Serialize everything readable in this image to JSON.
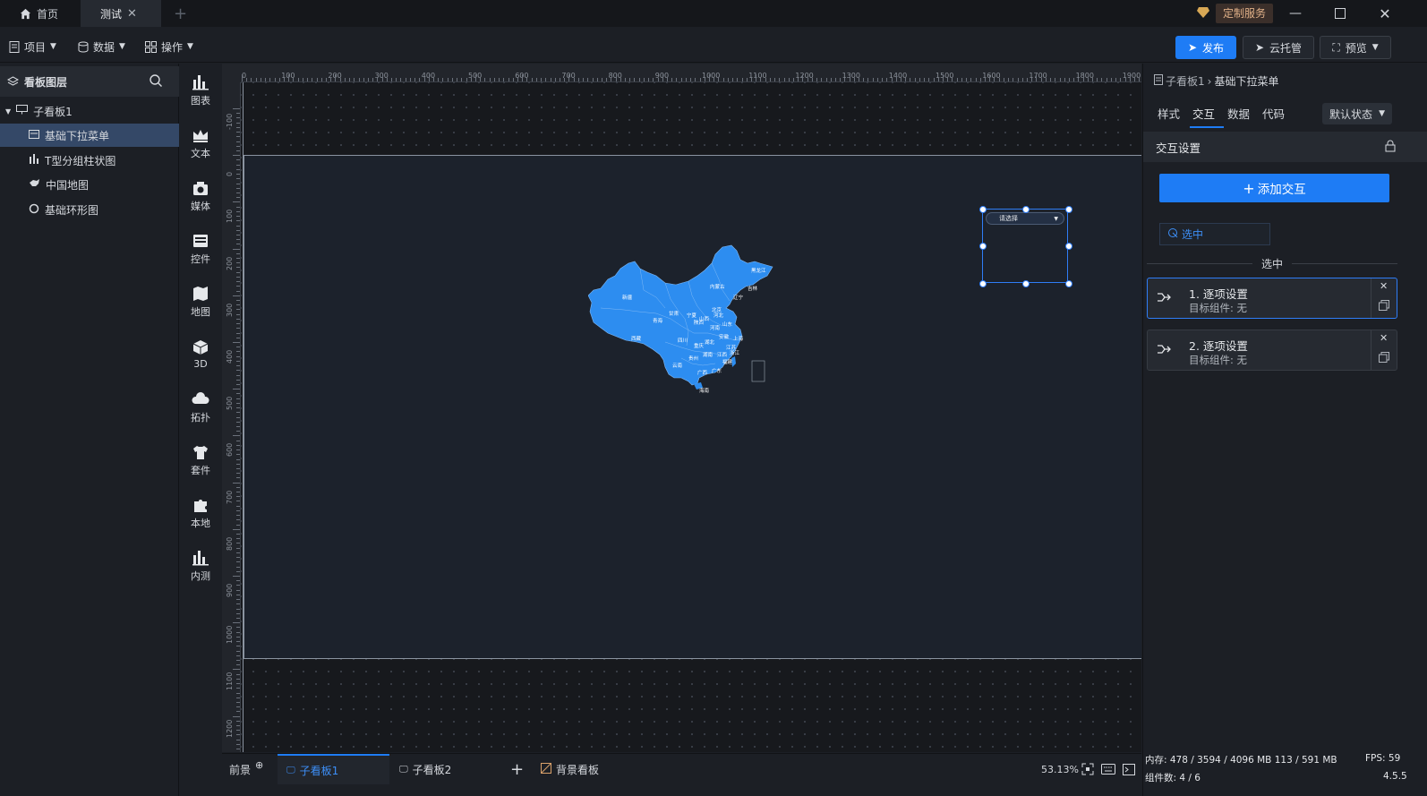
{
  "titlebar": {
    "tabs": [
      {
        "label": "首页"
      },
      {
        "label": "测试"
      }
    ],
    "custom_service": "定制服务"
  },
  "toolbar": {
    "menus": [
      "项目",
      "数据",
      "操作"
    ],
    "publish": "发布",
    "cloud_host": "云托管",
    "preview": "预览"
  },
  "layers": {
    "title": "看板图层",
    "board": "子看板1",
    "items": [
      "基础下拉菜单",
      "T型分组柱状图",
      "中国地图",
      "基础环形图"
    ]
  },
  "components": [
    "图表",
    "文本",
    "媒体",
    "控件",
    "地图",
    "3D",
    "拓扑",
    "套件",
    "本地",
    "内测"
  ],
  "ruler": {
    "top": [
      "0",
      "100",
      "200",
      "300",
      "400",
      "500",
      "600",
      "700",
      "800",
      "900",
      "1000",
      "1100",
      "1200",
      "1300",
      "1400",
      "1500",
      "1600",
      "1700",
      "1800",
      "1900"
    ],
    "left": [
      "-100",
      "0",
      "100",
      "200",
      "300",
      "400",
      "500",
      "600",
      "700",
      "800",
      "900",
      "1000",
      "1100",
      "1200"
    ]
  },
  "canvas": {
    "dropdown_placeholder": "请选择",
    "map_labels": [
      "新疆",
      "西藏",
      "青海",
      "甘肃",
      "内蒙古",
      "黑龙江",
      "吉林",
      "辽宁",
      "北京",
      "河北",
      "宁夏",
      "陕西",
      "山西",
      "河南",
      "山东",
      "四川",
      "重庆",
      "湖北",
      "安徽",
      "上海",
      "江苏",
      "浙江",
      "湖南",
      "江西",
      "贵州",
      "云南",
      "广西",
      "广东",
      "福建",
      "海南"
    ]
  },
  "bottombar": {
    "front": "前景",
    "boards": [
      "子看板1",
      "子看板2"
    ],
    "background": "背景看板",
    "zoom": "53.13%"
  },
  "rightpanel": {
    "breadcrumb_parent": "子看板1",
    "breadcrumb_current": "基础下拉菜单",
    "tabs": [
      "样式",
      "交互",
      "数据",
      "代码"
    ],
    "state": "默认状态",
    "section_title": "交互设置",
    "add_interaction": "添加交互",
    "event_chip": "选中",
    "divider_label": "选中",
    "interactions": [
      {
        "title": "1. 逐项设置",
        "subtitle": "目标组件: 无"
      },
      {
        "title": "2. 逐项设置",
        "subtitle": "目标组件: 无"
      }
    ]
  },
  "status": {
    "memory": "内存:  478 / 3594 / 4096 MB  113 / 591 MB",
    "fps": "FPS:  59",
    "components": "组件数: 4 / 6",
    "version": "4.5.5"
  },
  "colors": {
    "accent": "#1e7cf5",
    "map_fill": "#2d8df0",
    "selection": "#2f7df6"
  }
}
